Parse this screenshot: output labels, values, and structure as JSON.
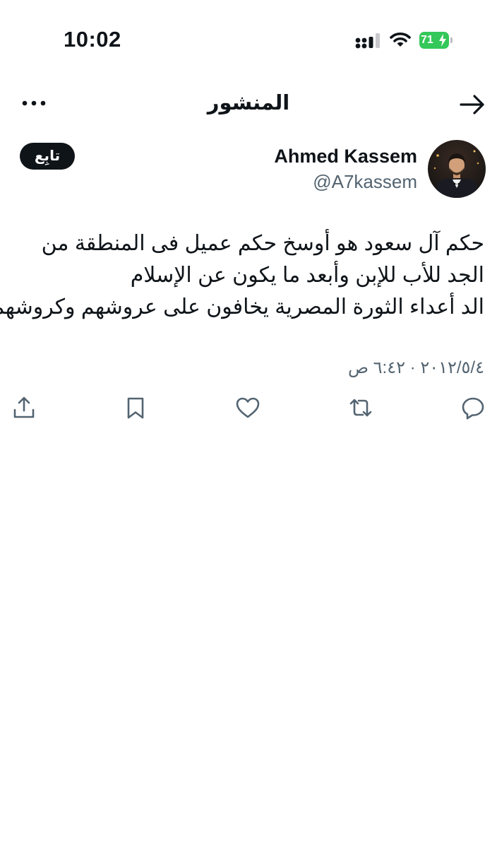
{
  "status_bar": {
    "time": "10:02",
    "battery_level": "71"
  },
  "nav": {
    "title": "المنشور",
    "back_icon": "arrow-right-icon",
    "more_icon": "more-dots-icon"
  },
  "author": {
    "name": "Ahmed Kassem",
    "handle": "@A7kassem",
    "follow_label": "تابِع"
  },
  "tweet": {
    "lines": [
      "حكم آل سعود هو أوسخ حكم عميل فى المنطقة من",
      "الجد للأب للإبن وأبعد ما يكون عن الإسلام",
      "الد أعداء الثورة المصرية يخافون على عروشهم وكروشهم"
    ],
    "timestamp": "٢٠١٢/٥/٤ · ٦:٤٢ ص"
  },
  "actions": [
    {
      "name": "reply",
      "icon": "reply-icon"
    },
    {
      "name": "retweet",
      "icon": "retweet-icon"
    },
    {
      "name": "like",
      "icon": "heart-icon"
    },
    {
      "name": "bookmark",
      "icon": "bookmark-icon"
    },
    {
      "name": "share",
      "icon": "share-icon"
    }
  ],
  "colors": {
    "text": "#0f1419",
    "secondary": "#536471",
    "battery": "#34c759",
    "follow_bg": "#0f1419"
  }
}
